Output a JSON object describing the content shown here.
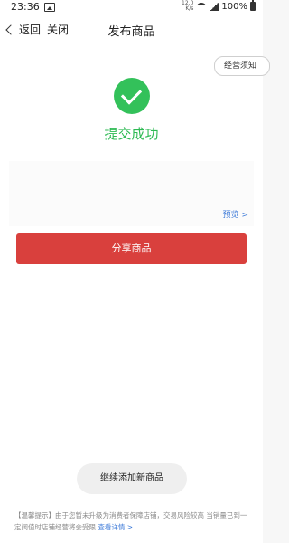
{
  "status_bar": {
    "time": "23:36",
    "speed_top": "12.0",
    "speed_bottom": "K/s",
    "battery": "100%",
    "icons": [
      "gallery-icon",
      "wifi-icon",
      "signal-icon",
      "battery-icon"
    ]
  },
  "nav": {
    "back_label": "返回",
    "close_label": "关闭",
    "title": "发布商品"
  },
  "main": {
    "notice_button": "经营须知",
    "success_text": "提交成功",
    "preview_link": "预览 >",
    "share_button": "分享商品",
    "continue_button": "继续添加新商品"
  },
  "tip": {
    "text": "【温馨提示】由于您暂未升级为消费者保障店铺，交易风险较高 当销量已到一定阀值时店铺经营将会受限",
    "link": "查看详情 >"
  },
  "colors": {
    "success": "#33c15a",
    "primary": "#d9403d",
    "link": "#3a78d8"
  }
}
